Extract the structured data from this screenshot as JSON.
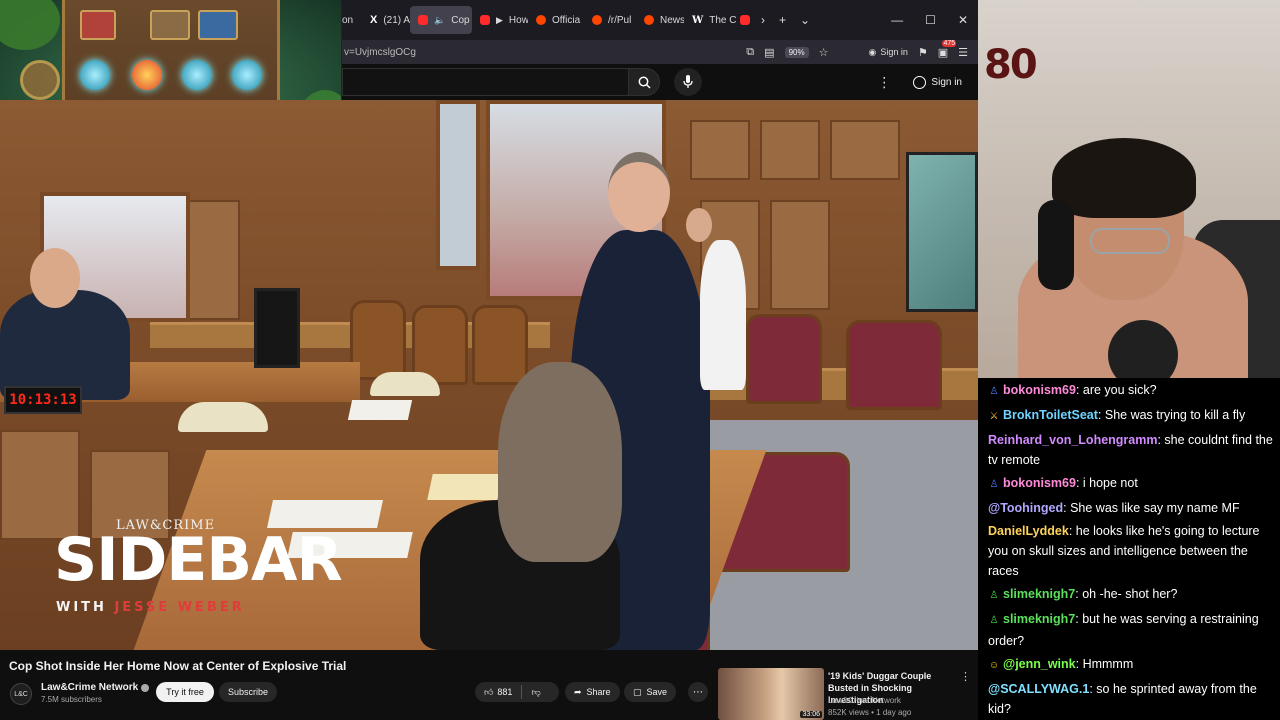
{
  "browser": {
    "tabs": [
      {
        "label": "on",
        "favicon_color": "#6a6a6a",
        "active": false
      },
      {
        "label": "(21) A",
        "favicon_color": "#ffffff",
        "icon": "x-logo-icon",
        "active": false
      },
      {
        "label": "Cop",
        "favicon_color": "#ff2a2a",
        "icon": "speaker-icon",
        "active": true
      },
      {
        "label": "How a",
        "favicon_color": "#ff2a2a",
        "active": false
      },
      {
        "label": "Officia",
        "favicon_color": "#ff4500",
        "active": false
      },
      {
        "label": "/r/Pul",
        "favicon_color": "#ff4500",
        "active": false
      },
      {
        "label": "News",
        "favicon_color": "#ff4500",
        "active": false
      },
      {
        "label": "The C",
        "favicon_color": "#ffffff",
        "icon": "wikipedia-icon",
        "active": false
      }
    ],
    "url": "v=UvjmcslgOCg",
    "zoom": "90%",
    "sign_in": "Sign in",
    "ext_count": "475"
  },
  "youtube": {
    "sign_in": "Sign in",
    "video_title": "Cop Shot Inside Her Home Now at Center of Explosive Trial",
    "channel_name": "Law&Crime Network",
    "channel_subs": "7.5M subscribers",
    "try_free": "Try it free",
    "subscribe": "Subscribe",
    "likes": "881",
    "share": "Share",
    "save": "Save",
    "recommended": {
      "title": "'19 Kids' Duggar Couple Busted in Shocking Investigation",
      "channel": "Law&Crime Network",
      "meta": "852K views • 1 day ago",
      "duration": "33:06"
    }
  },
  "video": {
    "clock": "10:13:13",
    "logo_small": "LAW&CRIME",
    "logo_main": "SIDEBAR",
    "logo_sub_prefix": "WITH ",
    "logo_sub_name": "JESSE WEBER"
  },
  "webcam": {
    "wall_number": "80"
  },
  "chat": [
    {
      "user": "bokonism69",
      "color": "#ff8ad8",
      "badge": "person-icon",
      "badge_color": "#4d7cff",
      "text": ": are you sick?"
    },
    {
      "user": "BroknToiletSeat",
      "color": "#6fd3ff",
      "badge": "sword-icon",
      "badge_color": "#f0c040",
      "text": ": She was trying to kill a fly"
    },
    {
      "user": "Reinhard_von_Lohengramm",
      "color": "#d18aff",
      "badge": "",
      "badge_color": "",
      "text": ": she couldnt find the tv remote"
    },
    {
      "user": "bokonism69",
      "color": "#ff8ad8",
      "badge": "person-icon",
      "badge_color": "#4d7cff",
      "text": ": i hope not"
    },
    {
      "user": "@Toohinged",
      "color": "#b0a8ff",
      "badge": "",
      "badge_color": "",
      "text": ": She was like say my name MF"
    },
    {
      "user": "DanielLyddek",
      "color": "#ffd35a",
      "badge": "",
      "badge_color": "",
      "text": ": he looks like he's going to lecture you on skull sizes and intelligence between the races"
    },
    {
      "user": "slimeknigh7",
      "color": "#5ce05c",
      "badge": "person-plus-icon",
      "badge_color": "#44d944",
      "text": ": oh -he- shot her?"
    },
    {
      "user": "slimeknigh7",
      "color": "#5ce05c",
      "badge": "person-plus-icon",
      "badge_color": "#44d944",
      "text": ": but he was serving a restraining order?"
    },
    {
      "user": "@jenn_wink",
      "color": "#7aff4d",
      "badge": "smile-icon",
      "badge_color": "#ffd400",
      "text": ": Hmmmm"
    },
    {
      "user": "@SCALLYWAG.1",
      "color": "#7fe0ff",
      "badge": "",
      "badge_color": "",
      "text": ": so he sprinted away from the kid?"
    }
  ]
}
